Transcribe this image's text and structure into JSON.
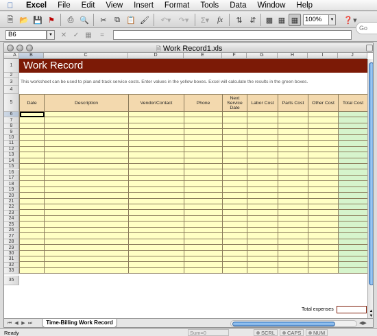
{
  "menu": {
    "app": "Excel",
    "items": [
      "File",
      "Edit",
      "View",
      "Insert",
      "Format",
      "Tools",
      "Data",
      "Window",
      "Help"
    ]
  },
  "toolbar": {
    "zoom": "100%",
    "icons": [
      "new-icon",
      "open-icon",
      "save-icon",
      "permission-icon",
      "print-icon",
      "print-preview-icon",
      "cut-icon",
      "copy-icon",
      "paste-icon",
      "format-painter-icon",
      "undo-icon",
      "redo-icon",
      "autosum-icon",
      "function-icon",
      "sort-ascending-icon",
      "sort-descending-icon",
      "chart-wizard-icon",
      "toolbox-icon",
      "help-icon"
    ]
  },
  "formula_bar": {
    "name_box": "B6",
    "formula": "",
    "search_hint": "Go"
  },
  "document": {
    "title": "Work Record1.xls",
    "columns": [
      "A",
      "B",
      "C",
      "D",
      "E",
      "F",
      "G",
      "H",
      "I",
      "J"
    ],
    "selected_column": "B",
    "rows": [
      "1",
      "2",
      "3",
      "4",
      "5",
      "6",
      "7",
      "8",
      "9",
      "10",
      "11",
      "12",
      "13",
      "14",
      "15",
      "16",
      "17",
      "18",
      "19",
      "20",
      "21",
      "22",
      "23",
      "24",
      "25",
      "26",
      "27",
      "28",
      "29",
      "30",
      "31",
      "32",
      "33",
      "35"
    ],
    "selected_row": "6"
  },
  "sheet": {
    "title": "Work Record",
    "instructions": "This worksheet can be used to plan and track service costs. Enter values in the yellow boxes. Excel will calculate the results in the green boxes.",
    "table_headers": [
      "Date",
      "Description",
      "Vendor/Contact",
      "Phone",
      "Next Service Date",
      "Labor Cost",
      "Parts Cost",
      "Other Cost",
      "Total Cost"
    ],
    "data_row_count": 28,
    "total_label": "Total expenses",
    "total_value": ""
  },
  "tabs": {
    "active": "Time-Billing Work Record"
  },
  "status": {
    "ready": "Ready",
    "sum": "Sum=0",
    "indicators": [
      "SCRL",
      "CAPS",
      "NUM"
    ]
  },
  "colors": {
    "title_band": "#7c1a06",
    "input_cells": "#ffffc4",
    "calc_cells": "#d6f4cc",
    "header_cells": "#f3d9ae"
  }
}
